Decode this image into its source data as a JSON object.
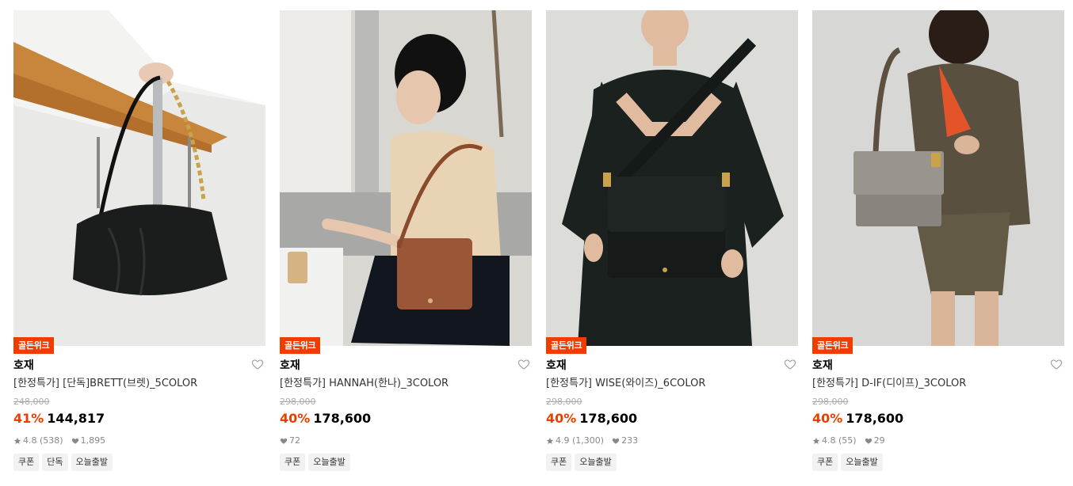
{
  "products": [
    {
      "badge": "골든위크",
      "brand": "호재",
      "name": "[한정특가] [단독]BRETT(브렛)_5COLOR",
      "original_price": "248,000",
      "discount": "41%",
      "price": "144,817",
      "rating": "4.8",
      "reviews": "(538)",
      "likes": "1,895",
      "tags": [
        "쿠폰",
        "단독",
        "오늘출발"
      ],
      "bag_color": "#1b1d1c"
    },
    {
      "badge": "골든위크",
      "brand": "호재",
      "name": "[한정특가] HANNAH(한나)_3COLOR",
      "original_price": "298,000",
      "discount": "40%",
      "price": "178,600",
      "rating": "",
      "reviews": "",
      "likes": "72",
      "tags": [
        "쿠폰",
        "오늘출발"
      ],
      "bag_color": "#9a5636"
    },
    {
      "badge": "골든위크",
      "brand": "호재",
      "name": "[한정특가] WISE(와이즈)_6COLOR",
      "original_price": "298,000",
      "discount": "40%",
      "price": "178,600",
      "rating": "4.9",
      "reviews": "(1,300)",
      "likes": "233",
      "tags": [
        "쿠폰",
        "오늘출발"
      ],
      "bag_color": "#1a211e"
    },
    {
      "badge": "골든위크",
      "brand": "호재",
      "name": "[한정특가] D-IF(디이프)_3COLOR",
      "original_price": "298,000",
      "discount": "40%",
      "price": "178,600",
      "rating": "4.8",
      "reviews": "(55)",
      "likes": "29",
      "tags": [
        "쿠폰",
        "오늘출발"
      ],
      "bag_color": "#8a847f"
    }
  ],
  "colors": {
    "accent": "#f03c00",
    "tag_bg": "#f2f2f2"
  },
  "icons": {
    "wishlist": "heart-outline-icon",
    "rating": "star-icon",
    "likes": "heart-filled-icon"
  }
}
